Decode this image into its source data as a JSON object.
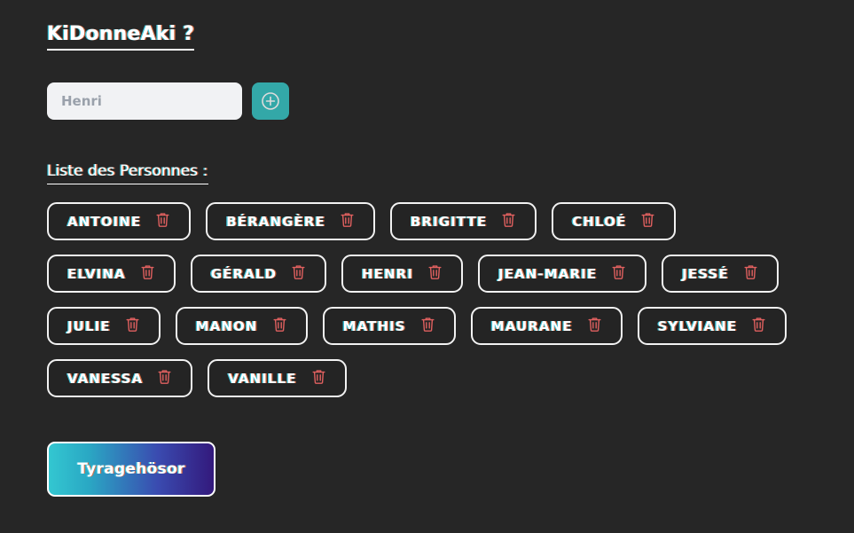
{
  "app": {
    "title": "KiDonneAki ?",
    "background_color": "#262626"
  },
  "add_form": {
    "input_placeholder": "Henri",
    "input_value": "",
    "add_button_icon": "plus-circle-icon",
    "add_button_color": "#33a8a8"
  },
  "list_section": {
    "heading": "Liste des Personnes :",
    "delete_icon": "trash-icon",
    "delete_icon_color": "#e0605f",
    "people": [
      {
        "name": "ANTOINE"
      },
      {
        "name": "BÉRANGÈRE"
      },
      {
        "name": "BRIGITTE"
      },
      {
        "name": "CHLOÉ"
      },
      {
        "name": "ELVINA"
      },
      {
        "name": "GÉRALD"
      },
      {
        "name": "HENRI"
      },
      {
        "name": "JEAN-MARIE"
      },
      {
        "name": "JESSÉ"
      },
      {
        "name": "JULIE"
      },
      {
        "name": "MANON"
      },
      {
        "name": "MATHIS"
      },
      {
        "name": "MAURANE"
      },
      {
        "name": "SYLVIANE"
      },
      {
        "name": "VANESSA"
      },
      {
        "name": "VANILLE"
      }
    ]
  },
  "draw_button": {
    "label": "Tyragehösor",
    "gradient_start": "#33c7d1",
    "gradient_end": "#33197c"
  }
}
